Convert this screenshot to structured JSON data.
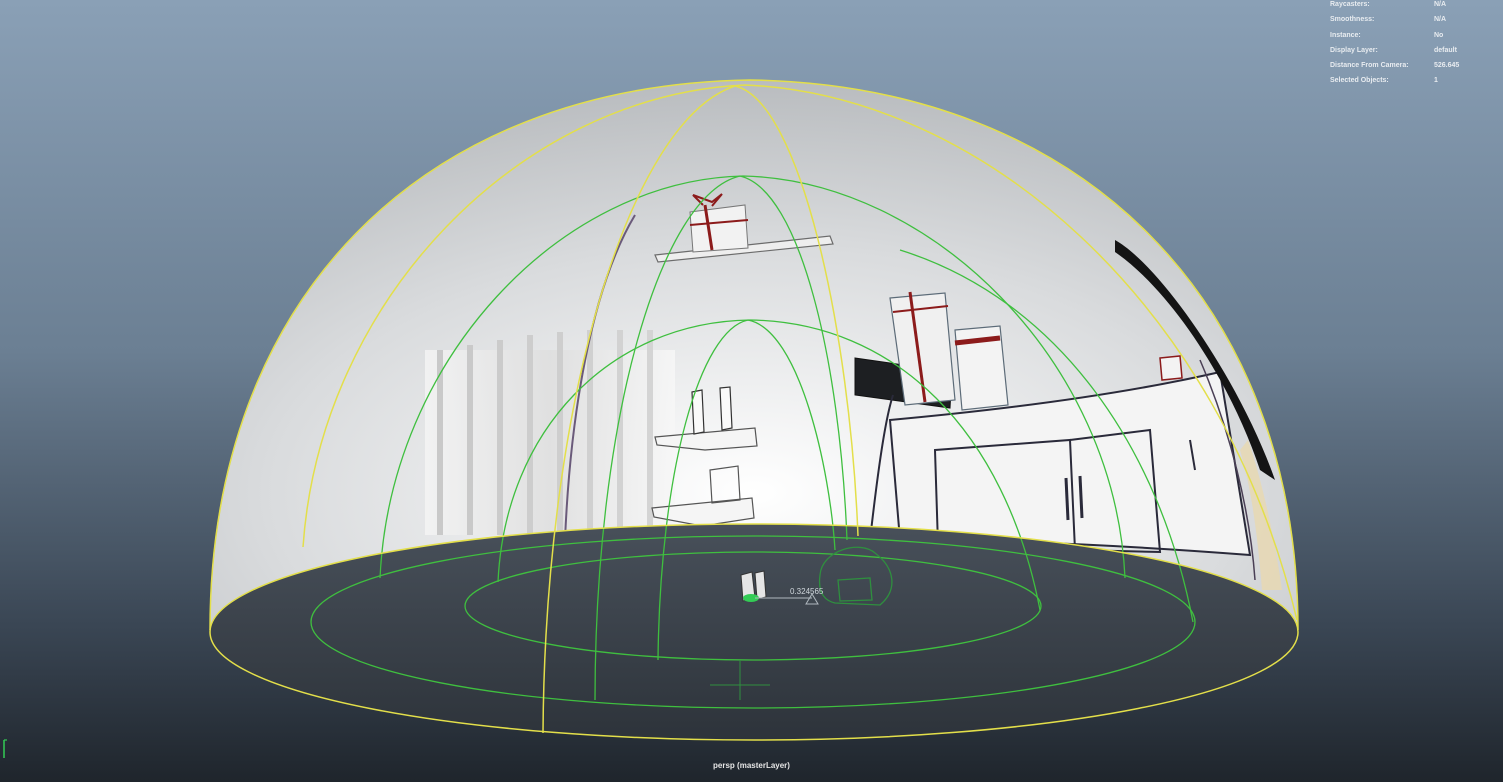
{
  "viewport": {
    "camera_label": "persp (masterLayer)",
    "measure_value": "0.324565"
  },
  "hud": {
    "rows": [
      {
        "key": "Raycasters:",
        "value": "N/A"
      },
      {
        "key": "Smoothness:",
        "value": "N/A"
      },
      {
        "key": "Instance:",
        "value": "No"
      },
      {
        "key": "Display Layer:",
        "value": "default"
      },
      {
        "key": "Distance From Camera:",
        "value": "526.645"
      },
      {
        "key": "Selected Objects:",
        "value": "1"
      }
    ]
  },
  "colors": {
    "wireframe_yellow": "#e3df4a",
    "wireframe_green": "#3fbf3f",
    "dome_surface": "#cfd1d3",
    "floor": "#3a4048",
    "background_top": "#8aa0b6",
    "background_bottom": "#1f252c"
  }
}
